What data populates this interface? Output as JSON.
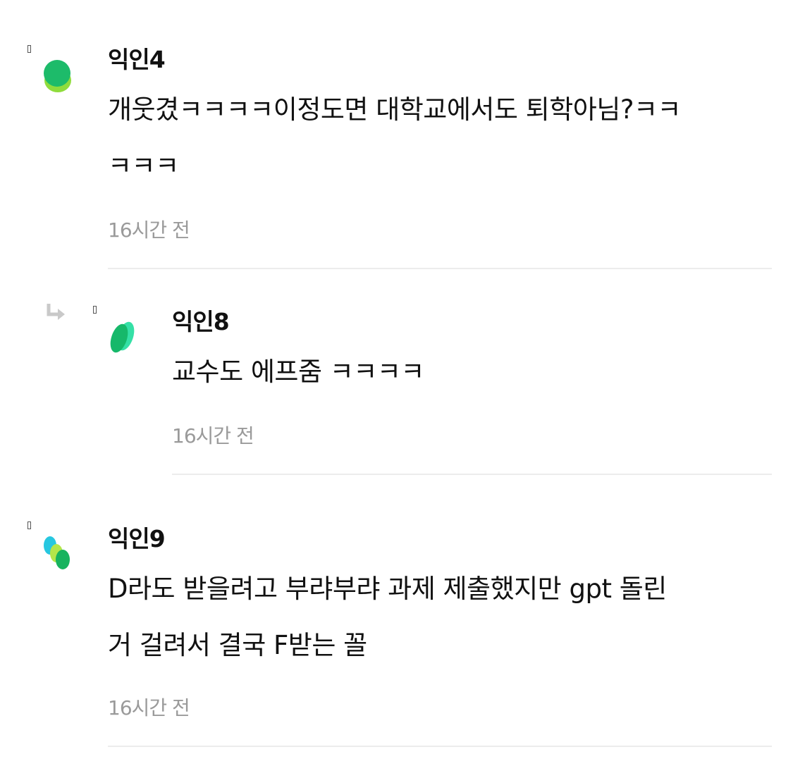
{
  "comments": [
    {
      "author": "익인4",
      "body_line1": "개웃겼ㅋㅋㅋㅋ이정도면 대학교에서도 퇴학아님?ㅋㅋ",
      "body_line2": "ㅋㅋㅋ",
      "time": "16시간 전",
      "is_reply": false,
      "avatar_colors": [
        "#1dbb6a",
        "#8fdc3c"
      ]
    },
    {
      "author": "익인8",
      "body_line1": "교수도 에프줌 ㅋㅋㅋㅋ",
      "time": "16시간 전",
      "is_reply": true,
      "avatar_colors": [
        "#16b86a",
        "#35e0a6"
      ]
    },
    {
      "author": "익인9",
      "body_line1": "D라도 받을려고 부랴부랴 과제 제출했지만 gpt 돌린",
      "body_line2": "거 걸려서 결국 F받는 꼴",
      "time": "16시간 전",
      "is_reply": false,
      "avatar_colors": [
        "#27c7e0",
        "#b4e64a",
        "#17b35e"
      ]
    }
  ]
}
